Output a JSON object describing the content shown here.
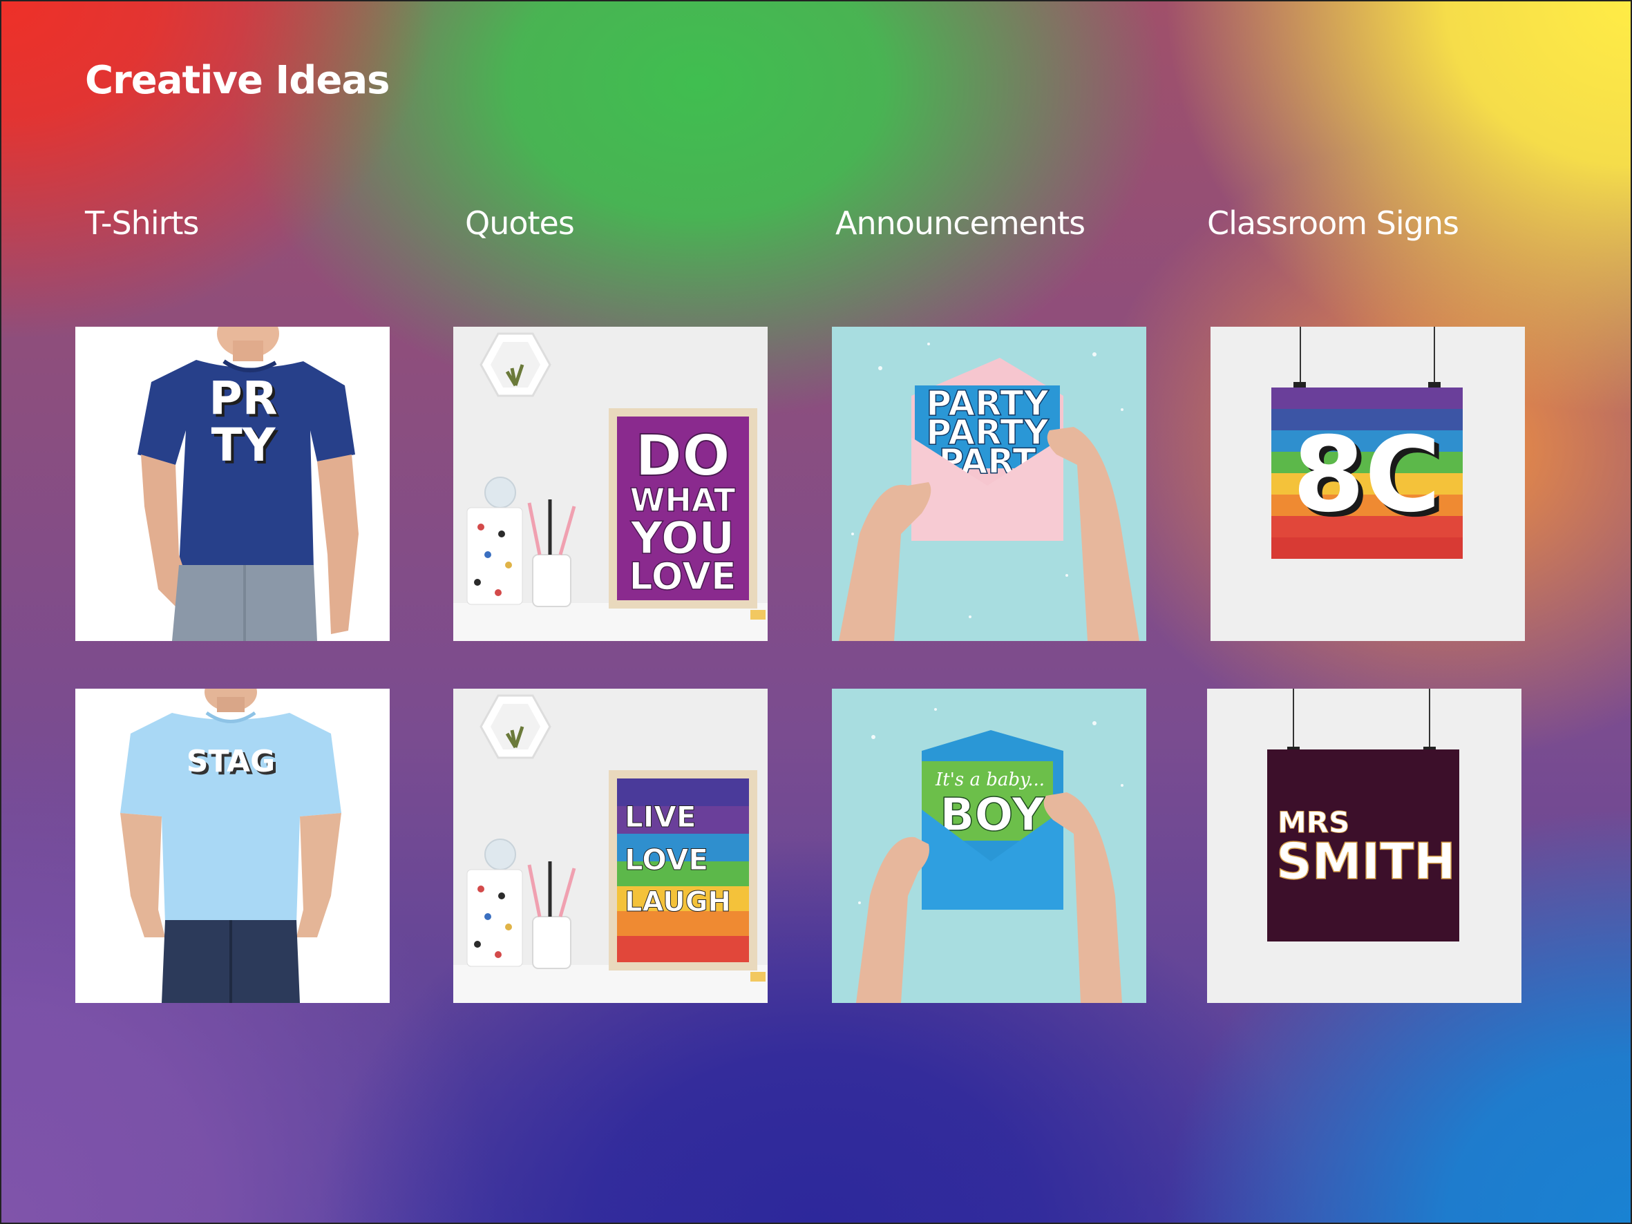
{
  "page": {
    "title": "Creative Ideas"
  },
  "columns": [
    {
      "label": "T-Shirts"
    },
    {
      "label": "Quotes"
    },
    {
      "label": "Announcements"
    },
    {
      "label": "Classroom Signs"
    }
  ],
  "tiles": {
    "tshirt_party": {
      "lines": [
        "PR",
        "TY"
      ]
    },
    "tshirt_stag": {
      "lines": [
        "STAG"
      ]
    },
    "quote_do": {
      "lines": [
        "DO",
        "WHAT",
        "YOU",
        "LOVE"
      ]
    },
    "quote_live": {
      "lines": [
        "LIVE",
        "LOVE",
        "LAUGH"
      ]
    },
    "announce_party": {
      "lines": [
        "PARTY",
        "PARTY",
        "PART"
      ]
    },
    "announce_boy": {
      "script": "It's a baby...",
      "big": "BOY"
    },
    "sign_8c": {
      "lines": [
        "8C"
      ]
    },
    "sign_smith": {
      "lines": [
        "MRS",
        "SMITH"
      ]
    }
  },
  "colors": {
    "navy_shirt": "#27408a",
    "light_shirt": "#a9d8f5",
    "purple_poster": "#8a2a8e",
    "teal_bg": "#a8dde0",
    "pink_card": "#f6c6cf",
    "blue_card": "#2a97d6",
    "green_card": "#6cbf4a",
    "maroon_poster": "#3c0f2a"
  }
}
